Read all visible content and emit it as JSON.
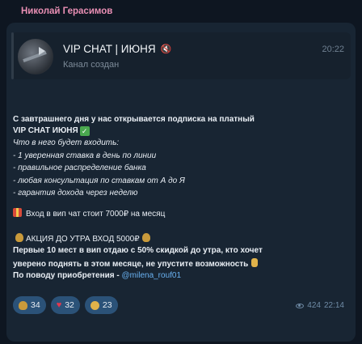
{
  "sender": "Николай Герасимов",
  "forward": {
    "title": "VIP CHAT | ИЮНЯ",
    "subtitle": "Канал создан",
    "time": "20:22"
  },
  "message": {
    "line1": "С завтрашнего дня у нас открывается подписка на платный",
    "line2": "VIP СНАТ ИЮНЯ",
    "line3": "Что в него будет входить:",
    "items": [
      "- 1 уверенная ставка в день по линии",
      "- правильное распределение банка",
      "- любая консультация по ставкам от А до Я",
      "- гарантия дохода через неделю"
    ],
    "price": "Вход в вип чат стоит 7000₽ на месяц",
    "promo_title": "АКЦИЯ ДО УТРА ВХОД 5000₽",
    "promo_body1": "Первые 10 мест в вип отдаю с 50% скидкой до утра, кто хочет",
    "promo_body2": "уверено поднять в этом месяце, не упустите возможность",
    "contact_label": "По поводу приобретения - ",
    "contact_link": "@milena_rouf01"
  },
  "reactions": [
    {
      "icon": "money-bag-icon",
      "count": "34"
    },
    {
      "icon": "heart-icon",
      "count": "32"
    },
    {
      "icon": "muscle-icon",
      "count": "23"
    }
  ],
  "views": "424",
  "time": "22:14"
}
